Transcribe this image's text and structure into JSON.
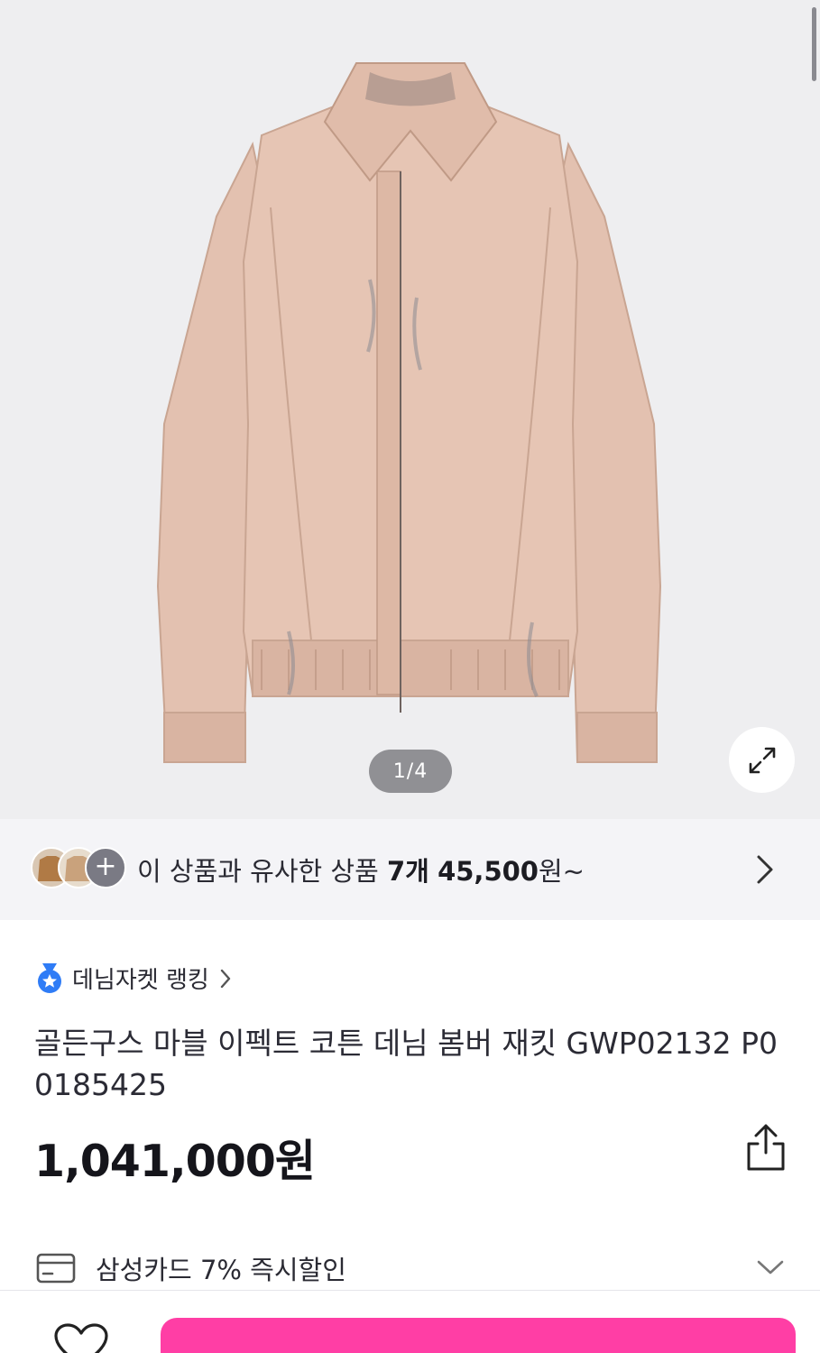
{
  "gallery": {
    "page_indicator": "1/4",
    "image_alt": "pink denim bomber jacket",
    "expand_icon": "expand-arrows-icon"
  },
  "similar": {
    "prefix": "이 상품과 유사한 상품",
    "count": "7개",
    "price": "45,500",
    "suffix": "원~",
    "more_icon": "plus-icon"
  },
  "ranking": {
    "label": "데님자켓 랭킹",
    "icon": "medal-icon"
  },
  "product": {
    "title": "골든구스 마블 이펙트 코튼 데님 봄버 재킷 GWP02132 P0 0185425",
    "price": "1,041,000원"
  },
  "benefit": {
    "label": "삼성카드 7% 즉시할인",
    "icon": "credit-card-icon"
  },
  "bottom": {
    "buy_label": "",
    "like_icon": "heart-icon"
  },
  "colors": {
    "accent": "#ff3ea5",
    "gallery_bg": "#eeeef0",
    "jacket": "#e2bfae",
    "medal": "#2f7cf6"
  }
}
